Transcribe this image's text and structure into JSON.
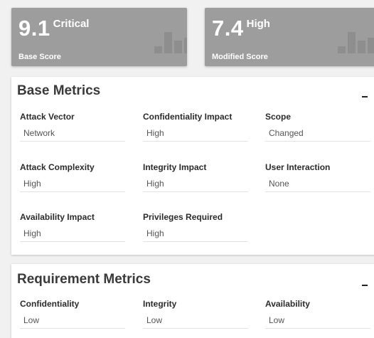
{
  "base_score": {
    "value": "9.1",
    "severity": "Critical",
    "label": "Base Score"
  },
  "modified_score": {
    "value": "7.4",
    "severity": "High",
    "label": "Modified Score"
  },
  "base_metrics": {
    "title": "Base Metrics",
    "items": [
      {
        "label": "Attack Vector",
        "value": "Network"
      },
      {
        "label": "Confidentiality Impact",
        "value": "High"
      },
      {
        "label": "Scope",
        "value": "Changed"
      },
      {
        "label": "Attack Complexity",
        "value": "High"
      },
      {
        "label": "Integrity Impact",
        "value": "High"
      },
      {
        "label": "User Interaction",
        "value": "None"
      },
      {
        "label": "Availability Impact",
        "value": "High"
      },
      {
        "label": "Privileges Required",
        "value": "High"
      }
    ]
  },
  "requirement_metrics": {
    "title": "Requirement Metrics",
    "items": [
      {
        "label": "Confidentiality",
        "value": "Low"
      },
      {
        "label": "Integrity",
        "value": "Low"
      },
      {
        "label": "Availability",
        "value": "Low"
      }
    ]
  },
  "colors": {
    "score_card_bg": "#9d9d9d",
    "panel_bg": "#ffffff",
    "page_bg": "#f1f1f1"
  }
}
